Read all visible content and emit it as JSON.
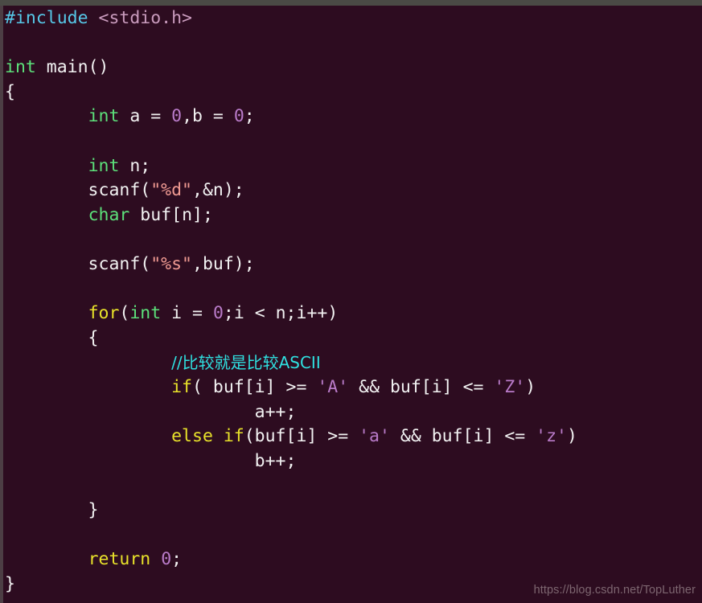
{
  "window": {
    "top_bar_color": "#4a4a45",
    "left_bar_color": "#4c3e44",
    "background_color": "#2d0c20"
  },
  "editor": {
    "language": "C",
    "colors": {
      "preprocessor": "#56c8e8",
      "header": "#c99bbd",
      "type": "#5ce07a",
      "keyword": "#e8e22a",
      "number": "#b97bc9",
      "string": "#f09a92",
      "comment": "#2fe0e0",
      "plain": "#f2f2f2",
      "background": "#2d0c20"
    },
    "lines": [
      {
        "n": 1,
        "tokens": [
          {
            "t": "#include ",
            "c": "t-pre"
          },
          {
            "t": "<stdio.h>",
            "c": "t-hdr"
          }
        ]
      },
      {
        "n": 2,
        "tokens": []
      },
      {
        "n": 3,
        "tokens": [
          {
            "t": "int",
            "c": "t-type"
          },
          {
            "t": " main()",
            "c": "t-plain"
          }
        ]
      },
      {
        "n": 4,
        "tokens": [
          {
            "t": "{",
            "c": "t-plain"
          }
        ]
      },
      {
        "n": 5,
        "tokens": [
          {
            "t": "        ",
            "c": "t-plain"
          },
          {
            "t": "int",
            "c": "t-type"
          },
          {
            "t": " a = ",
            "c": "t-plain"
          },
          {
            "t": "0",
            "c": "t-num"
          },
          {
            "t": ",b = ",
            "c": "t-plain"
          },
          {
            "t": "0",
            "c": "t-num"
          },
          {
            "t": ";",
            "c": "t-plain"
          }
        ]
      },
      {
        "n": 6,
        "tokens": []
      },
      {
        "n": 7,
        "tokens": [
          {
            "t": "        ",
            "c": "t-plain"
          },
          {
            "t": "int",
            "c": "t-type"
          },
          {
            "t": " n;",
            "c": "t-plain"
          }
        ]
      },
      {
        "n": 8,
        "tokens": [
          {
            "t": "        scanf(",
            "c": "t-plain"
          },
          {
            "t": "\"%d\"",
            "c": "t-str"
          },
          {
            "t": ",&n);",
            "c": "t-plain"
          }
        ]
      },
      {
        "n": 9,
        "tokens": [
          {
            "t": "        ",
            "c": "t-plain"
          },
          {
            "t": "char",
            "c": "t-type"
          },
          {
            "t": " buf[n];",
            "c": "t-plain"
          }
        ]
      },
      {
        "n": 10,
        "tokens": []
      },
      {
        "n": 11,
        "tokens": [
          {
            "t": "        scanf(",
            "c": "t-plain"
          },
          {
            "t": "\"%s\"",
            "c": "t-str"
          },
          {
            "t": ",buf);",
            "c": "t-plain"
          }
        ]
      },
      {
        "n": 12,
        "tokens": []
      },
      {
        "n": 13,
        "tokens": [
          {
            "t": "        ",
            "c": "t-plain"
          },
          {
            "t": "for",
            "c": "t-kw"
          },
          {
            "t": "(",
            "c": "t-plain"
          },
          {
            "t": "int",
            "c": "t-type"
          },
          {
            "t": " i = ",
            "c": "t-plain"
          },
          {
            "t": "0",
            "c": "t-num"
          },
          {
            "t": ";i < n;i++)",
            "c": "t-plain"
          }
        ]
      },
      {
        "n": 14,
        "tokens": [
          {
            "t": "        {",
            "c": "t-plain"
          }
        ]
      },
      {
        "n": 15,
        "tokens": [
          {
            "t": "                ",
            "c": "t-plain"
          },
          {
            "t": "//比较就是比较ASCII",
            "c": "t-cmt"
          }
        ]
      },
      {
        "n": 16,
        "tokens": [
          {
            "t": "                ",
            "c": "t-plain"
          },
          {
            "t": "if",
            "c": "t-kw"
          },
          {
            "t": "( buf[i] >= ",
            "c": "t-plain"
          },
          {
            "t": "'A'",
            "c": "t-num"
          },
          {
            "t": " && buf[i] <= ",
            "c": "t-plain"
          },
          {
            "t": "'Z'",
            "c": "t-num"
          },
          {
            "t": ")",
            "c": "t-plain"
          }
        ]
      },
      {
        "n": 17,
        "tokens": [
          {
            "t": "                        a++;",
            "c": "t-plain"
          }
        ]
      },
      {
        "n": 18,
        "tokens": [
          {
            "t": "                ",
            "c": "t-plain"
          },
          {
            "t": "else if",
            "c": "t-kw"
          },
          {
            "t": "(buf[i] >= ",
            "c": "t-plain"
          },
          {
            "t": "'a'",
            "c": "t-num"
          },
          {
            "t": " && buf[i] <= ",
            "c": "t-plain"
          },
          {
            "t": "'z'",
            "c": "t-num"
          },
          {
            "t": ")",
            "c": "t-plain"
          }
        ]
      },
      {
        "n": 19,
        "tokens": [
          {
            "t": "                        b++;",
            "c": "t-plain"
          }
        ]
      },
      {
        "n": 20,
        "tokens": []
      },
      {
        "n": 21,
        "tokens": [
          {
            "t": "        }",
            "c": "t-plain"
          }
        ]
      },
      {
        "n": 22,
        "tokens": []
      },
      {
        "n": 23,
        "tokens": [
          {
            "t": "        ",
            "c": "t-plain"
          },
          {
            "t": "return",
            "c": "t-kw"
          },
          {
            "t": " ",
            "c": "t-plain"
          },
          {
            "t": "0",
            "c": "t-num"
          },
          {
            "t": ";",
            "c": "t-plain"
          }
        ]
      },
      {
        "n": 24,
        "tokens": [
          {
            "t": "}",
            "c": "t-plain"
          }
        ]
      }
    ]
  },
  "watermark": {
    "text": "https://blog.csdn.net/TopLuther"
  }
}
